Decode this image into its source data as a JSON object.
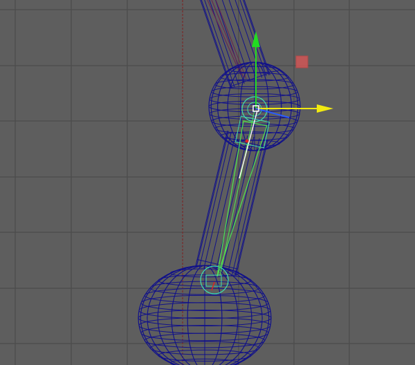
{
  "viewport": {
    "background_color": "#5e5e5e",
    "grid_color": "#4b4b4b",
    "axis_line_color": "#7a2a2a"
  },
  "scene": {
    "wireframe_color": "#11118a",
    "joint_color": "#3ee0b0",
    "bone_color": "#4ee84e",
    "selected_color": "#ffffff"
  },
  "manipulator": {
    "y_axis_color": "#22dd22",
    "x_axis_color": "#f2ea10",
    "z_axis_color": "#2a5cff",
    "center_color": "#ffffff"
  },
  "marker": {
    "icon": "locator-square-icon",
    "color": "#d05656"
  }
}
